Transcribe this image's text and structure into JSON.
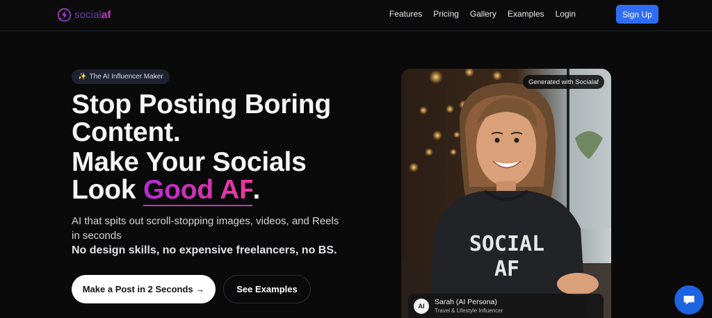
{
  "nav": {
    "logo_part1": "social",
    "logo_part2": "af",
    "links": [
      "Features",
      "Pricing",
      "Gallery",
      "Examples",
      "Login"
    ],
    "signup_label": "Sign Up"
  },
  "hero": {
    "badge_icon": "sparkles-icon",
    "badge_label": "The AI Influencer Maker",
    "headline_line1": "Stop Posting Boring Content.",
    "headline_line2_prefix": "Make Your Socials Look ",
    "headline_highlight": "Good AF",
    "headline_suffix": ".",
    "subtext": "AI that spits out scroll-stopping images, videos, and Reels in seconds",
    "subtext_bold": "No design skills, no expensive freelancers, no BS.",
    "cta_primary": "Make a Post in 2 Seconds →",
    "cta_secondary": "See Examples"
  },
  "showcase": {
    "tag": "Generated with Socialaf",
    "shirt_text_line1": "SOCIAL",
    "shirt_text_line2": "AF",
    "persona_avatar": "AI",
    "persona_name": "Sarah (AI Persona)",
    "persona_role": "Travel & Lifestyle Influencer"
  },
  "colors": {
    "accent_blue": "#2f6cf5",
    "highlight_start": "#b52bd6",
    "highlight_end": "#ec3a9a",
    "background": "#0a0a0a"
  },
  "chat": {
    "icon": "chat-bubble-icon"
  }
}
